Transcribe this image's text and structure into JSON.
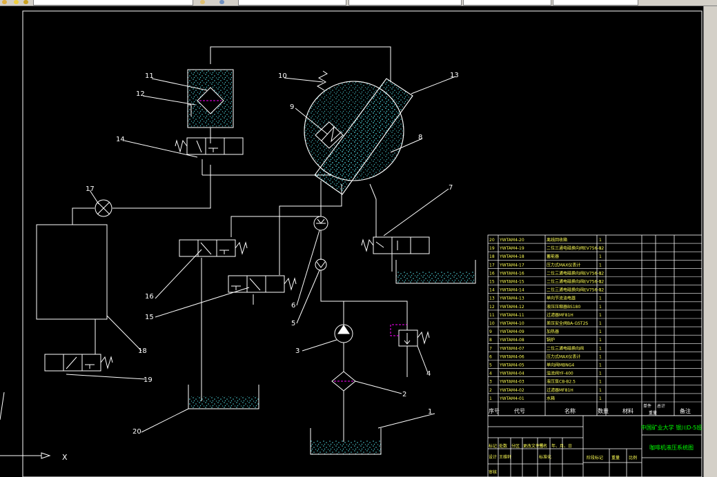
{
  "callouts": [
    "1",
    "2",
    "3",
    "4",
    "5",
    "6",
    "7",
    "8",
    "9",
    "10",
    "11",
    "12",
    "13",
    "14",
    "15",
    "16",
    "17",
    "18",
    "19",
    "20"
  ],
  "bom": {
    "rows": [
      {
        "no": "20",
        "code": "YWTAM4-20",
        "name": "离线回收箱",
        "qty": "1"
      },
      {
        "no": "19",
        "code": "YWTAM4-19",
        "name": "二位三通电磁换向阀EV756-02",
        "qty": "1"
      },
      {
        "no": "18",
        "code": "YWTAM4-18",
        "name": "蓄能器",
        "qty": "1"
      },
      {
        "no": "17",
        "code": "YWTAM4-17",
        "name": "压力式MAX仪表计",
        "qty": "1"
      },
      {
        "no": "16",
        "code": "YWTAM4-16",
        "name": "二位三通电磁换向阀EV756-02",
        "qty": "1"
      },
      {
        "no": "15",
        "code": "YWTAM4-15",
        "name": "二位三通电磁换向阀EV756-02",
        "qty": "1"
      },
      {
        "no": "14",
        "code": "YWTAM4-14",
        "name": "二位三通电磁换向阀EV756-02",
        "qty": "1"
      },
      {
        "no": "13",
        "code": "YWTAM4-13",
        "name": "单向节流油电器",
        "qty": "1"
      },
      {
        "no": "12",
        "code": "YWTAM4-12",
        "name": "液压压缩器BS180",
        "qty": "1"
      },
      {
        "no": "11",
        "code": "YWTAM4-11",
        "name": "过滤器MF81H",
        "qty": "1"
      },
      {
        "no": "10",
        "code": "YWTAM4-10",
        "name": "差压安全阀BA-GST2S",
        "qty": "1"
      },
      {
        "no": "9",
        "code": "YWTAM4-09",
        "name": "加热器",
        "qty": "1"
      },
      {
        "no": "8",
        "code": "YWTAM4-08",
        "name": "锅炉",
        "qty": "1"
      },
      {
        "no": "7",
        "code": "YWTAM4-07",
        "name": "二位三通电磁换向阀",
        "qty": "1"
      },
      {
        "no": "6",
        "code": "YWTAM4-06",
        "name": "压力式MAX仪表计",
        "qty": "1"
      },
      {
        "no": "5",
        "code": "YWTAM4-05",
        "name": "单向阀MBNG4",
        "qty": "1"
      },
      {
        "no": "4",
        "code": "YWTAM4-04",
        "name": "溢流阀YF-400",
        "qty": "1"
      },
      {
        "no": "3",
        "code": "YWTAM4-03",
        "name": "液压泵CB-B2.5",
        "qty": "1"
      },
      {
        "no": "2",
        "code": "YWTAM4-02",
        "name": "过滤器MF81H",
        "qty": "1"
      },
      {
        "no": "1",
        "code": "YWTAM4-01",
        "name": "水箱",
        "qty": "1"
      }
    ],
    "header": {
      "no": "序号",
      "code": "代号",
      "name": "名称",
      "qty": "数量",
      "material": "材料",
      "unit_weight": "单件",
      "total_weight": "总计",
      "weight": "重量",
      "remarks": "备注"
    }
  },
  "title_block": {
    "school": "中国矿业大学 银川D-5班",
    "drawing_title": "咖啡机液压系统图",
    "rev_labels": [
      "标记",
      "处数",
      "分区",
      "更改文件号",
      "签名",
      "年、月、日"
    ],
    "design_labels": [
      "设计",
      "王维轩",
      "标准化"
    ],
    "stage_labels": [
      "阶段标记",
      "重量",
      "比例"
    ],
    "review_label": "审核"
  },
  "ucs": {
    "x_label": "X"
  },
  "colors": {
    "background": "#000000",
    "line": "#ffffff",
    "hatch": "#4fd1d9",
    "accent": "#ff2a2a",
    "title_text": "#00ff00",
    "dashed": "#ff00ff",
    "table_text": "#ffff55"
  }
}
